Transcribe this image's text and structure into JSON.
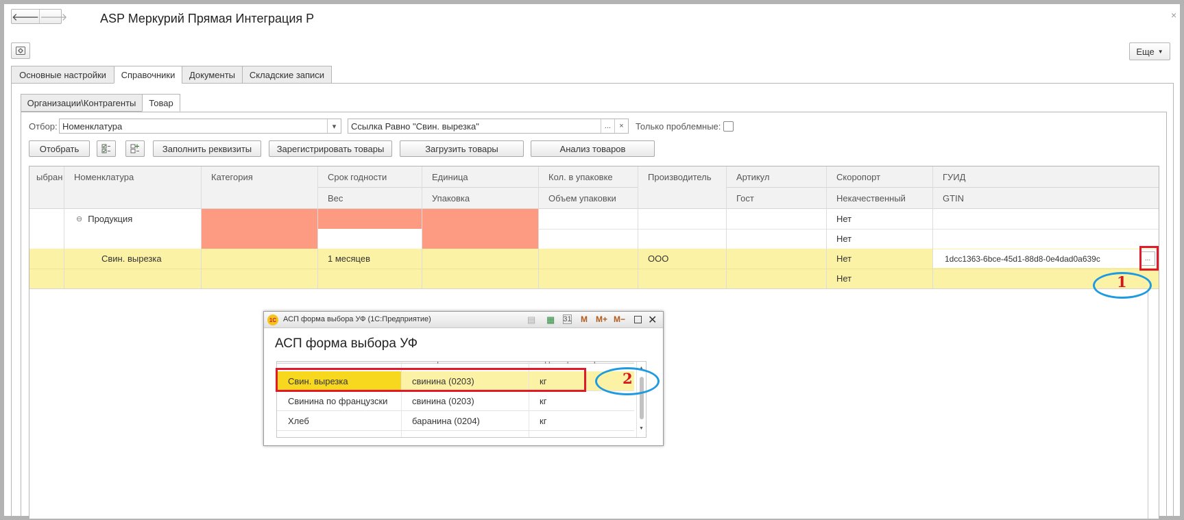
{
  "window": {
    "title": "ASP Меркурий Прямая Интеграция Р",
    "close": "×"
  },
  "nav": {
    "back": "🡐",
    "forward": "🡒"
  },
  "toolbar": {
    "more_label": "Еще"
  },
  "main_tabs": [
    "Основные настройки",
    "Справочники",
    "Документы",
    "Складские записи"
  ],
  "sub_tabs": [
    "Организации\\Контрагенты",
    "Товар"
  ],
  "filter": {
    "label": "Отбор:",
    "field_value": "Номенклатура",
    "condition_value": "Ссылка Равно \"Свин. вырезка\"",
    "ellipsis": "...",
    "clear": "×",
    "problem_only_label": "Только проблемные:"
  },
  "actions": {
    "select": "Отобрать",
    "fill": "Заполнить реквизиты",
    "register": "Зарегистрировать товары",
    "load": "Загрузить товары",
    "analyze": "Анализ товаров"
  },
  "grid": {
    "columns_top": [
      "ыбран",
      "Номенклатура",
      "Категория",
      "Срок годности",
      "Единица",
      "Кол. в упаковке",
      "Производитель",
      "Артикул",
      "Скоропорт",
      "ГУИД"
    ],
    "columns_bottom": [
      "Вес",
      "Упаковка",
      "Объем упаковки",
      "Гост",
      "Некачественный",
      "GTIN"
    ],
    "group_row": {
      "toggle": "⊖",
      "name": "Продукция",
      "perishable": "Нет",
      "poor_quality": "Нет"
    },
    "item_row": {
      "name": "Свин. вырезка",
      "shelf_life": "1 месяцев",
      "producer": "ООО",
      "perishable": "Нет",
      "guid": "1dcc1363-6bce-45d1-88d8-0e4dad0a639c",
      "poor_quality": "Нет",
      "ellipsis": "..."
    }
  },
  "dialog": {
    "bar_title": "АСП форма выбора УФ  (1С:Предприятие)",
    "app_logo": "1С",
    "header": "АСП форма выбора УФ",
    "columns": [
      "Наименование",
      "Категория",
      "Единица измерения"
    ],
    "rows": [
      {
        "name": "Свин. вырезка",
        "category": "свинина (0203)",
        "unit": "кг"
      },
      {
        "name": "Свинина по французски",
        "category": "свинина (0203)",
        "unit": "кг"
      },
      {
        "name": "Хлеб",
        "category": "баранина (0204)",
        "unit": "кг"
      }
    ],
    "bar_buttons": {
      "m": "M",
      "mplus": "M+",
      "mminus": "M−"
    }
  },
  "annotations": {
    "one": "1",
    "two": "2"
  },
  "colors": {
    "highlight_row": "#fbf2a5",
    "selected_cell": "#f7d81f",
    "error_fill": "#fd9a82",
    "marker_red": "#e0192b",
    "marker_blue": "#1e9ae0"
  }
}
